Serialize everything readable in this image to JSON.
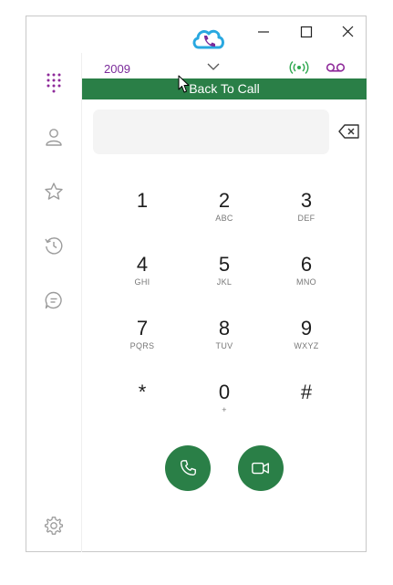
{
  "extension": {
    "number": "2009"
  },
  "banner": {
    "label": "Back To Call"
  },
  "dialpad": {
    "keys": [
      {
        "digit": "1",
        "letters": ""
      },
      {
        "digit": "2",
        "letters": "ABC"
      },
      {
        "digit": "3",
        "letters": "DEF"
      },
      {
        "digit": "4",
        "letters": "GHI"
      },
      {
        "digit": "5",
        "letters": "JKL"
      },
      {
        "digit": "6",
        "letters": "MNO"
      },
      {
        "digit": "7",
        "letters": "PQRS"
      },
      {
        "digit": "8",
        "letters": "TUV"
      },
      {
        "digit": "9",
        "letters": "WXYZ"
      },
      {
        "digit": "*",
        "letters": ""
      },
      {
        "digit": "0",
        "letters": "+"
      },
      {
        "digit": "#",
        "letters": ""
      }
    ]
  },
  "sidebar": {
    "items": [
      {
        "icon": "dialpad-icon",
        "active": true
      },
      {
        "icon": "contacts-icon",
        "active": false
      },
      {
        "icon": "favorites-star-icon",
        "active": false
      },
      {
        "icon": "history-icon",
        "active": false
      },
      {
        "icon": "chat-icon",
        "active": false
      },
      {
        "icon": "settings-gear-icon",
        "active": false
      }
    ]
  },
  "status": {
    "connected_icon": "signal-broadcast-icon",
    "voicemail_icon": "voicemail-icon"
  },
  "colors": {
    "brand_green": "#2a7f47",
    "accent_purple": "#7a2a9a",
    "status_green": "#2ea84f",
    "logo_blue": "#29a8e0"
  }
}
